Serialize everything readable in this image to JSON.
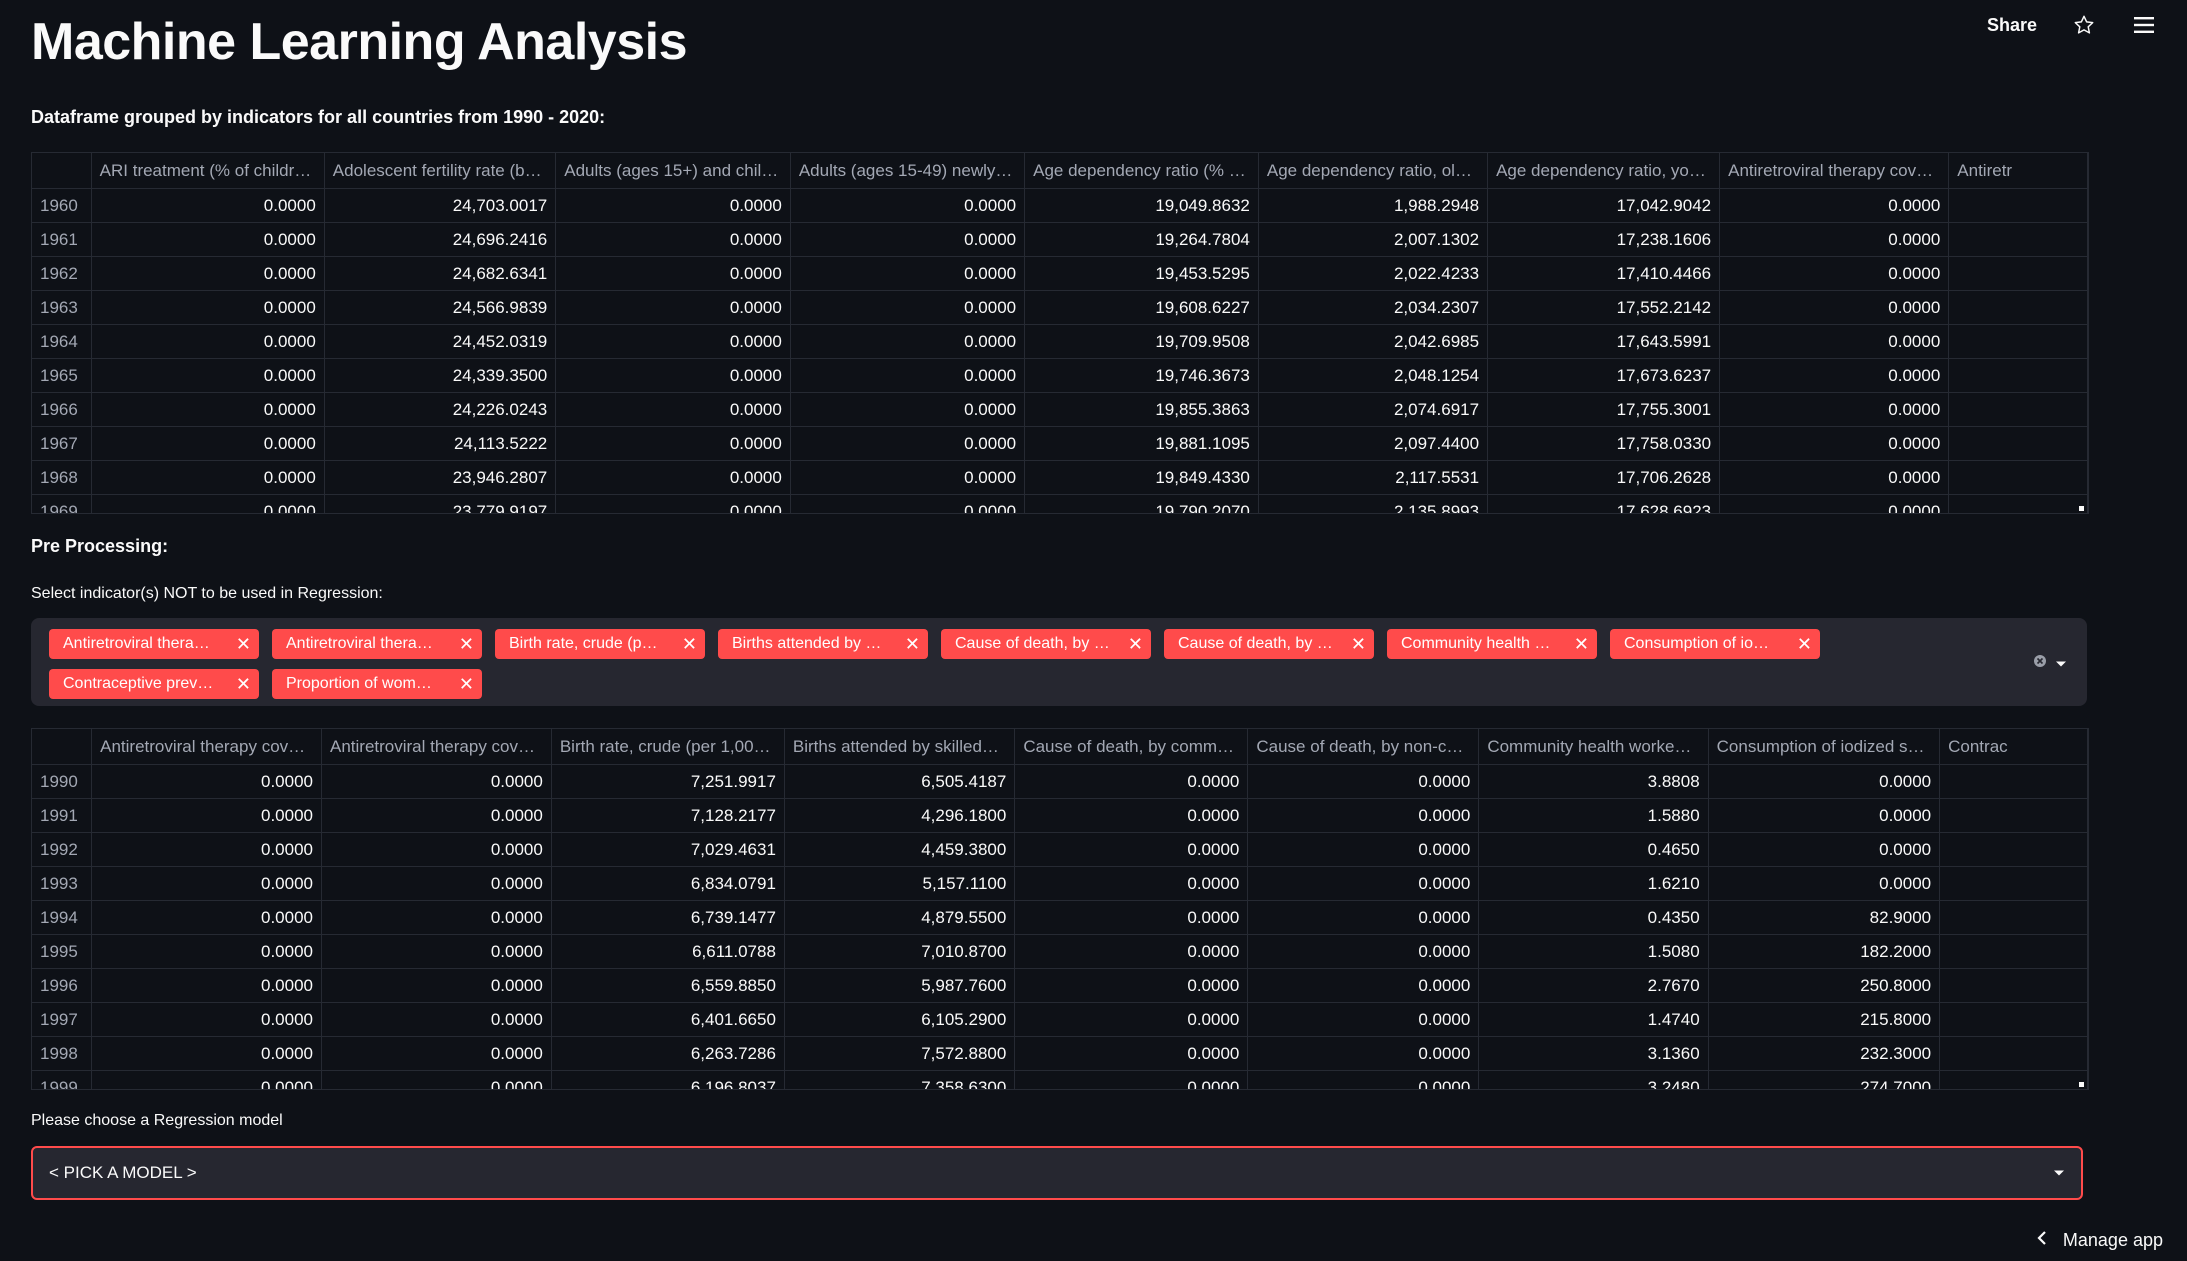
{
  "app": {
    "title": "Machine Learning Analysis",
    "share_label": "Share",
    "manage_app_label": "Manage app"
  },
  "section1": {
    "heading": "Dataframe grouped by indicators for all countries from 1990 - 2020:"
  },
  "table1": {
    "columns": [
      "ARI treatment (% of childr…",
      "Adolescent fertility rate (b…",
      "Adults (ages 15+) and chil…",
      "Adults (ages 15-49) newly…",
      "Age dependency ratio (% …",
      "Age dependency ratio, ol…",
      "Age dependency ratio, yo…",
      "Antiretroviral therapy cov…",
      "Antiretr"
    ],
    "rows": [
      {
        "index": "1960",
        "cells": [
          "0.0000",
          "24,703.0017",
          "0.0000",
          "0.0000",
          "19,049.8632",
          "1,988.2948",
          "17,042.9042",
          "0.0000",
          ""
        ]
      },
      {
        "index": "1961",
        "cells": [
          "0.0000",
          "24,696.2416",
          "0.0000",
          "0.0000",
          "19,264.7804",
          "2,007.1302",
          "17,238.1606",
          "0.0000",
          ""
        ]
      },
      {
        "index": "1962",
        "cells": [
          "0.0000",
          "24,682.6341",
          "0.0000",
          "0.0000",
          "19,453.5295",
          "2,022.4233",
          "17,410.4466",
          "0.0000",
          ""
        ]
      },
      {
        "index": "1963",
        "cells": [
          "0.0000",
          "24,566.9839",
          "0.0000",
          "0.0000",
          "19,608.6227",
          "2,034.2307",
          "17,552.2142",
          "0.0000",
          ""
        ]
      },
      {
        "index": "1964",
        "cells": [
          "0.0000",
          "24,452.0319",
          "0.0000",
          "0.0000",
          "19,709.9508",
          "2,042.6985",
          "17,643.5991",
          "0.0000",
          ""
        ]
      },
      {
        "index": "1965",
        "cells": [
          "0.0000",
          "24,339.3500",
          "0.0000",
          "0.0000",
          "19,746.3673",
          "2,048.1254",
          "17,673.6237",
          "0.0000",
          ""
        ]
      },
      {
        "index": "1966",
        "cells": [
          "0.0000",
          "24,226.0243",
          "0.0000",
          "0.0000",
          "19,855.3863",
          "2,074.6917",
          "17,755.3001",
          "0.0000",
          ""
        ]
      },
      {
        "index": "1967",
        "cells": [
          "0.0000",
          "24,113.5222",
          "0.0000",
          "0.0000",
          "19,881.1095",
          "2,097.4400",
          "17,758.0330",
          "0.0000",
          ""
        ]
      },
      {
        "index": "1968",
        "cells": [
          "0.0000",
          "23,946.2807",
          "0.0000",
          "0.0000",
          "19,849.4330",
          "2,117.5531",
          "17,706.2628",
          "0.0000",
          ""
        ]
      },
      {
        "index": "1969",
        "cells": [
          "0.0000",
          "23,779.9197",
          "0.0000",
          "0.0000",
          "19,790.2070",
          "2,135.8993",
          "17,628.6923",
          "0.0000",
          ""
        ]
      }
    ]
  },
  "section2": {
    "heading": "Pre Processing:",
    "select_label": "Select indicator(s) NOT to be used in Regression:"
  },
  "multiselect": {
    "chips": [
      "Antiretroviral thera…",
      "Antiretroviral thera…",
      "Birth rate, crude (p…",
      "Births attended by …",
      "Cause of death, by …",
      "Cause of death, by …",
      "Community health …",
      "Consumption of io…",
      "Contraceptive prev…",
      "Proportion of wom…"
    ],
    "chip_color": "#ff4b4b"
  },
  "table2": {
    "columns": [
      "Antiretroviral therapy cov…",
      "Antiretroviral therapy cov…",
      "Birth rate, crude (per 1,00…",
      "Births attended by skilled…",
      "Cause of death, by comm…",
      "Cause of death, by non-c…",
      "Community health worke…",
      "Consumption of iodized s…",
      "Contrac"
    ],
    "rows": [
      {
        "index": "1990",
        "cells": [
          "0.0000",
          "0.0000",
          "7,251.9917",
          "6,505.4187",
          "0.0000",
          "0.0000",
          "3.8808",
          "0.0000",
          ""
        ]
      },
      {
        "index": "1991",
        "cells": [
          "0.0000",
          "0.0000",
          "7,128.2177",
          "4,296.1800",
          "0.0000",
          "0.0000",
          "1.5880",
          "0.0000",
          ""
        ]
      },
      {
        "index": "1992",
        "cells": [
          "0.0000",
          "0.0000",
          "7,029.4631",
          "4,459.3800",
          "0.0000",
          "0.0000",
          "0.4650",
          "0.0000",
          ""
        ]
      },
      {
        "index": "1993",
        "cells": [
          "0.0000",
          "0.0000",
          "6,834.0791",
          "5,157.1100",
          "0.0000",
          "0.0000",
          "1.6210",
          "0.0000",
          ""
        ]
      },
      {
        "index": "1994",
        "cells": [
          "0.0000",
          "0.0000",
          "6,739.1477",
          "4,879.5500",
          "0.0000",
          "0.0000",
          "0.4350",
          "82.9000",
          ""
        ]
      },
      {
        "index": "1995",
        "cells": [
          "0.0000",
          "0.0000",
          "6,611.0788",
          "7,010.8700",
          "0.0000",
          "0.0000",
          "1.5080",
          "182.2000",
          ""
        ]
      },
      {
        "index": "1996",
        "cells": [
          "0.0000",
          "0.0000",
          "6,559.8850",
          "5,987.7600",
          "0.0000",
          "0.0000",
          "2.7670",
          "250.8000",
          ""
        ]
      },
      {
        "index": "1997",
        "cells": [
          "0.0000",
          "0.0000",
          "6,401.6650",
          "6,105.2900",
          "0.0000",
          "0.0000",
          "1.4740",
          "215.8000",
          ""
        ]
      },
      {
        "index": "1998",
        "cells": [
          "0.0000",
          "0.0000",
          "6,263.7286",
          "7,572.8800",
          "0.0000",
          "0.0000",
          "3.1360",
          "232.3000",
          ""
        ]
      },
      {
        "index": "1999",
        "cells": [
          "0.0000",
          "0.0000",
          "6,196.8037",
          "7,358.6300",
          "0.0000",
          "0.0000",
          "3.2480",
          "274.7000",
          ""
        ]
      }
    ]
  },
  "section3": {
    "model_label": "Please choose a Regression model",
    "model_select_value": "< PICK A MODEL >"
  },
  "colors": {
    "background": "#0e1117",
    "accent": "#ff4b4b",
    "widget_bg": "#262730"
  },
  "icons": {
    "star": "star-icon",
    "menu": "hamburger-menu-icon",
    "clear": "clear-all-icon",
    "dropdown": "chevron-down-icon",
    "chevron_left": "chevron-left-icon"
  }
}
